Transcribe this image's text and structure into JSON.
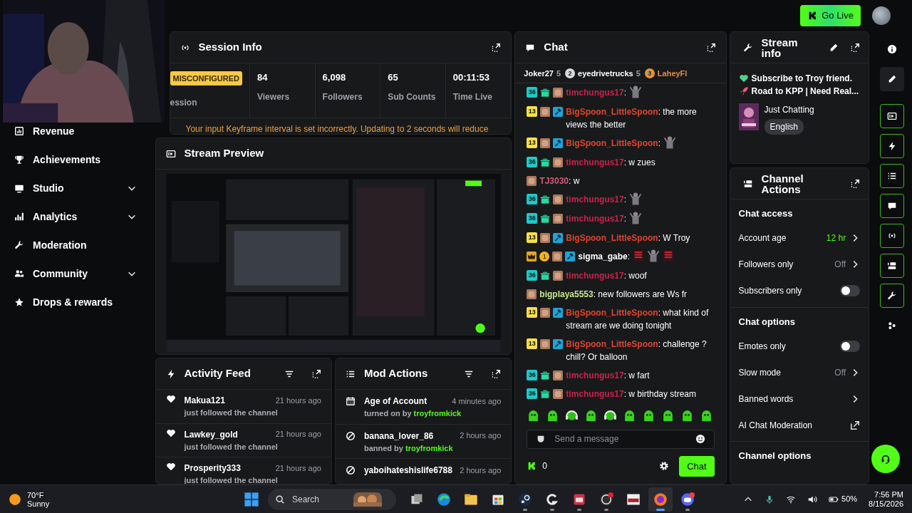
{
  "header": {
    "go_live": "Go Live"
  },
  "sidebar": {
    "items": [
      {
        "label": "Revenue",
        "expandable": false
      },
      {
        "label": "Achievements",
        "expandable": false
      },
      {
        "label": "Studio",
        "expandable": true
      },
      {
        "label": "Analytics",
        "expandable": true
      },
      {
        "label": "Moderation",
        "expandable": false
      },
      {
        "label": "Community",
        "expandable": true
      },
      {
        "label": "Drops & rewards",
        "expandable": false
      }
    ]
  },
  "session_info": {
    "title": "Session Info",
    "stats": [
      {
        "kind": "badge",
        "value": "MISCONFIGURED",
        "label": "ession"
      },
      {
        "kind": "number",
        "value": "84",
        "label": "Viewers"
      },
      {
        "kind": "number",
        "value": "6,098",
        "label": "Followers"
      },
      {
        "kind": "number",
        "value": "65",
        "label": "Sub Counts"
      },
      {
        "kind": "number",
        "value": "00:11:53",
        "label": "Time Live"
      }
    ],
    "warning": "Your input Keyframe interval is set incorrectly. Updating to 2 seconds will reduce"
  },
  "stream_preview": {
    "title": "Stream Preview"
  },
  "activity_feed": {
    "title": "Activity Feed",
    "items": [
      {
        "name": "Makua121",
        "detail": "just followed the channel",
        "time": "21 hours ago"
      },
      {
        "name": "Lawkey_gold",
        "detail": "just followed the channel",
        "time": "21 hours ago"
      },
      {
        "name": "Prosperity333",
        "detail": "just followed the channel",
        "time": "21 hours ago"
      }
    ]
  },
  "mod_actions": {
    "title": "Mod Actions",
    "items": [
      {
        "kind": "setting",
        "title": "Age of Account",
        "action": "turned on by",
        "moderator": "troyfromkick",
        "time": "4 minutes ago"
      },
      {
        "kind": "ban",
        "title": "banana_lover_86",
        "action": "banned by",
        "moderator": "troyfromkick",
        "time": "2 hours ago"
      },
      {
        "kind": "ban",
        "title": "yaboihateshislife6788",
        "time": "2 hours ago"
      }
    ]
  },
  "chat": {
    "title": "Chat",
    "gifters": [
      {
        "name": "Joker27",
        "count": "5"
      },
      {
        "rank": "2",
        "color": "#d9d9d9",
        "name": "eyedrivetrucks",
        "count": "5"
      },
      {
        "rank": "3",
        "color": "#e0913f",
        "name": "LaheyFl"
      }
    ],
    "messages": [
      {
        "badges": [
          {
            "kind": "sub",
            "label": "36",
            "color": "#1fc9c9"
          },
          {
            "kind": "gift"
          },
          {
            "kind": "avatar"
          }
        ],
        "user": "timchungus17",
        "color": "#c8234a",
        "text": ":",
        "emotes": [
          {
            "kind": "figure"
          }
        ]
      },
      {
        "badges": [
          {
            "kind": "sub",
            "label": "13",
            "color": "#f5e04a"
          },
          {
            "kind": "avatar"
          },
          {
            "kind": "mod"
          }
        ],
        "user": "BigSpoon_LittleSpoon",
        "color": "#e0452e",
        "text": ": the more views the better"
      },
      {
        "badges": [
          {
            "kind": "sub",
            "label": "13",
            "color": "#f5e04a"
          },
          {
            "kind": "avatar"
          },
          {
            "kind": "mod"
          }
        ],
        "user": "BigSpoon_LittleSpoon",
        "color": "#e0452e",
        "text": ":",
        "emotes": [
          {
            "kind": "figure"
          }
        ]
      },
      {
        "badges": [
          {
            "kind": "sub",
            "label": "36",
            "color": "#1fc9c9"
          },
          {
            "kind": "gift"
          },
          {
            "kind": "avatar"
          }
        ],
        "user": "timchungus17",
        "color": "#c8234a",
        "text": ": w zues"
      },
      {
        "badges": [
          {
            "kind": "avatar"
          }
        ],
        "user": "TJ3030",
        "color": "#d4587a",
        "text": ": w"
      },
      {
        "badges": [
          {
            "kind": "sub",
            "label": "36",
            "color": "#1fc9c9"
          },
          {
            "kind": "gift"
          },
          {
            "kind": "avatar"
          }
        ],
        "user": "timchungus17",
        "color": "#c8234a",
        "text": ":",
        "emotes": [
          {
            "kind": "figure"
          }
        ]
      },
      {
        "badges": [
          {
            "kind": "sub",
            "label": "36",
            "color": "#1fc9c9"
          },
          {
            "kind": "gift"
          },
          {
            "kind": "avatar"
          }
        ],
        "user": "timchungus17",
        "color": "#c8234a",
        "text": ":",
        "emotes": [
          {
            "kind": "figure"
          }
        ]
      },
      {
        "badges": [
          {
            "kind": "sub",
            "label": "13",
            "color": "#f5e04a"
          },
          {
            "kind": "avatar"
          },
          {
            "kind": "mod"
          }
        ],
        "user": "BigSpoon_LittleSpoon",
        "color": "#e0452e",
        "text": ": W Troy"
      },
      {
        "badges": [
          {
            "kind": "crown"
          },
          {
            "kind": "rank",
            "label": "1"
          },
          {
            "kind": "avatar"
          },
          {
            "kind": "mod"
          }
        ],
        "user": "sigma_gabe",
        "color": "#ffffff",
        "text": ":",
        "emotes": [
          {
            "kind": "sign"
          },
          {
            "kind": "figure"
          },
          {
            "kind": "sign"
          }
        ]
      },
      {
        "badges": [
          {
            "kind": "sub",
            "label": "36",
            "color": "#1fc9c9"
          },
          {
            "kind": "gift"
          },
          {
            "kind": "avatar"
          }
        ],
        "user": "timchungus17",
        "color": "#c8234a",
        "text": ": woof"
      },
      {
        "badges": [
          {
            "kind": "avatar"
          }
        ],
        "user": "bigplaya5553",
        "color": "#c5e88a",
        "text": ": new followers are Ws fr"
      },
      {
        "badges": [
          {
            "kind": "sub",
            "label": "13",
            "color": "#f5e04a"
          },
          {
            "kind": "avatar"
          },
          {
            "kind": "mod"
          }
        ],
        "user": "BigSpoon_LittleSpoon",
        "color": "#e0452e",
        "text": ": what kind of stream are we doing tonight"
      },
      {
        "badges": [
          {
            "kind": "sub",
            "label": "13",
            "color": "#f5e04a"
          },
          {
            "kind": "avatar"
          },
          {
            "kind": "mod"
          }
        ],
        "user": "BigSpoon_LittleSpoon",
        "color": "#e0452e",
        "text": ": challenge ? chill? Or balloon"
      },
      {
        "badges": [
          {
            "kind": "sub",
            "label": "36",
            "color": "#1fc9c9"
          },
          {
            "kind": "gift"
          },
          {
            "kind": "avatar"
          }
        ],
        "user": "timchungus17",
        "color": "#c8234a",
        "text": ": w fart"
      },
      {
        "badges": [
          {
            "kind": "sub",
            "label": "36",
            "color": "#1fc9c9"
          },
          {
            "kind": "gift"
          },
          {
            "kind": "avatar"
          }
        ],
        "user": "timchungus17",
        "color": "#c8234a",
        "text": ": w birthday stream"
      }
    ],
    "emote_bar": [
      {
        "kind": "blob"
      },
      {
        "kind": "blob"
      },
      {
        "kind": "headphones"
      },
      {
        "kind": "blob"
      },
      {
        "kind": "headphones"
      },
      {
        "kind": "blob"
      },
      {
        "kind": "blob"
      },
      {
        "kind": "blob"
      },
      {
        "kind": "blob"
      },
      {
        "kind": "blob"
      }
    ],
    "input": {
      "placeholder": "Send a message"
    },
    "points": "0",
    "send": "Chat"
  },
  "stream_info": {
    "title": "Stream info",
    "lines": [
      "Subscribe to Troy friend.",
      "Road to KPP | Need Real..."
    ],
    "category": "Just Chatting",
    "tags": [
      "English"
    ]
  },
  "channel_actions": {
    "title": "Channel Actions",
    "sections": [
      {
        "title": "Chat access",
        "rows": [
          {
            "kind": "value",
            "label": "Account age",
            "value": "12 hr",
            "highlight": true
          },
          {
            "kind": "value",
            "label": "Followers only",
            "value": "Off",
            "highlight": false
          },
          {
            "kind": "toggle",
            "label": "Subscribers only",
            "on": false
          }
        ]
      },
      {
        "title": "Chat options",
        "rows": [
          {
            "kind": "toggle",
            "label": "Emotes only",
            "on": false
          },
          {
            "kind": "value",
            "label": "Slow mode",
            "value": "Off",
            "highlight": false
          },
          {
            "kind": "link",
            "label": "Banned words"
          },
          {
            "kind": "external",
            "label": "AI Chat Moderation"
          }
        ]
      },
      {
        "title": "Channel options"
      }
    ]
  },
  "rail": [
    {
      "open": false,
      "selected": false
    },
    {
      "open": false,
      "selected": true
    },
    {
      "open": true,
      "selected": false
    },
    {
      "open": true,
      "selected": false
    },
    {
      "open": true,
      "selected": false
    },
    {
      "open": true,
      "selected": false
    },
    {
      "open": true,
      "selected": false
    },
    {
      "open": true,
      "selected": false
    },
    {
      "open": true,
      "selected": false
    },
    {
      "open": false,
      "selected": false
    }
  ],
  "taskbar": {
    "weather": {
      "temp": "70°F",
      "condition": "Sunny"
    },
    "search": {
      "placeholder": "Search"
    },
    "apps": [
      {
        "running": false,
        "selected": false
      },
      {
        "running": false,
        "selected": false
      },
      {
        "running": false,
        "selected": false
      },
      {
        "running": false,
        "selected": false
      },
      {
        "running": true,
        "selected": false
      },
      {
        "running": true,
        "selected": false
      },
      {
        "running": true,
        "selected": false
      },
      {
        "running": true,
        "selected": false
      },
      {
        "running": false,
        "selected": false
      },
      {
        "running": true,
        "selected": true
      },
      {
        "running": true,
        "selected": false
      }
    ],
    "battery": "50%",
    "time": "7:56 PM",
    "date": "8/15/2026"
  }
}
